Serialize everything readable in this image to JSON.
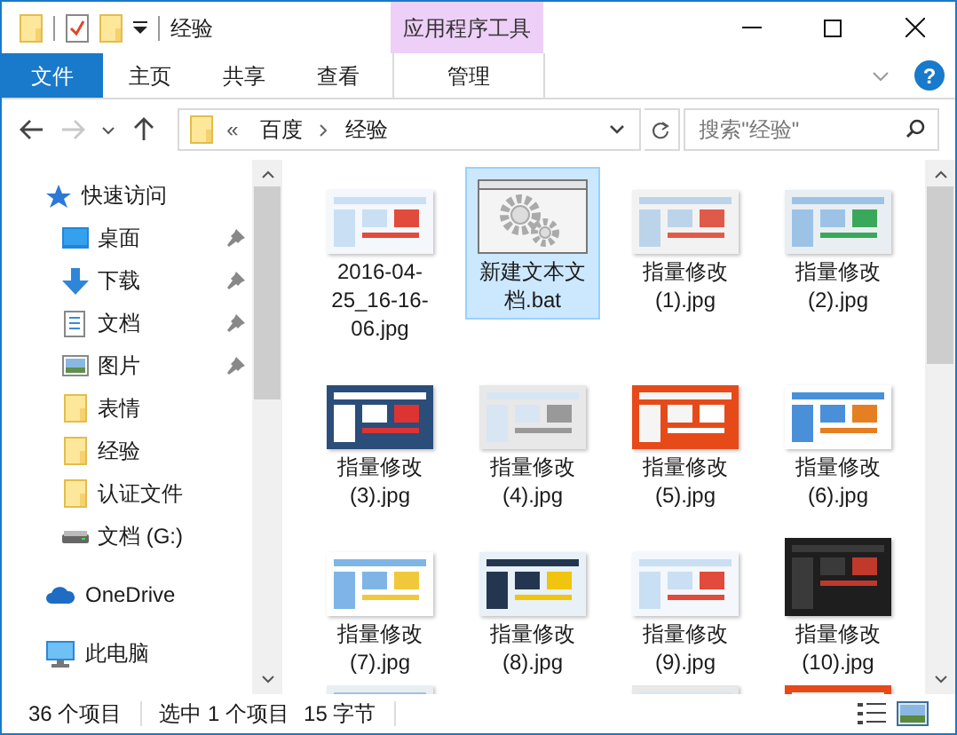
{
  "window": {
    "title": "经验"
  },
  "context_tab": {
    "label": "应用程序工具"
  },
  "ribbon_tabs": [
    {
      "label": "文件",
      "kind": "file"
    },
    {
      "label": "主页",
      "kind": "normal"
    },
    {
      "label": "共享",
      "kind": "normal"
    },
    {
      "label": "查看",
      "kind": "normal"
    },
    {
      "label": "管理",
      "kind": "context"
    }
  ],
  "help_button": {
    "label": "?"
  },
  "navigation_buttons": {
    "forward_disabled": true
  },
  "address": {
    "overflow": "«",
    "path": [
      "百度",
      "经验"
    ]
  },
  "search": {
    "placeholder": "搜索\"经验\""
  },
  "sidebar": [
    {
      "label": "快速访问",
      "kind": "quick",
      "children": [
        {
          "label": "桌面",
          "kind": "desktop",
          "pinned": true
        },
        {
          "label": "下载",
          "kind": "download",
          "pinned": true
        },
        {
          "label": "文档",
          "kind": "document",
          "pinned": true
        },
        {
          "label": "图片",
          "kind": "pictures",
          "pinned": true
        },
        {
          "label": "表情",
          "kind": "folder",
          "pinned": false
        },
        {
          "label": "经验",
          "kind": "folder",
          "pinned": false
        },
        {
          "label": "认证文件",
          "kind": "folder",
          "pinned": false
        },
        {
          "label": "文档 (G:)",
          "kind": "drive",
          "pinned": false
        }
      ]
    },
    {
      "label": "OneDrive",
      "kind": "cloud"
    },
    {
      "label": "此电脑",
      "kind": "pc"
    }
  ],
  "files": [
    {
      "name": "2016-04-25_16-16-06.jpg",
      "selected": false
    },
    {
      "name": "新建文本文档.bat",
      "kind": "batch",
      "selected": true
    },
    {
      "name": "指量修改(1).jpg",
      "selected": false
    },
    {
      "name": "指量修改(2).jpg",
      "selected": false
    },
    {
      "name": "指量修改(3).jpg",
      "selected": false
    },
    {
      "name": "指量修改(4).jpg",
      "selected": false
    },
    {
      "name": "指量修改(5).jpg",
      "selected": false
    },
    {
      "name": "指量修改(6).jpg",
      "selected": false
    },
    {
      "name": "指量修改(7).jpg",
      "selected": false
    },
    {
      "name": "指量修改(8).jpg",
      "selected": false
    },
    {
      "name": "指量修改(9).jpg",
      "selected": false
    },
    {
      "name": "指量修改(10).jpg",
      "selected": false
    }
  ],
  "partial_row": [
    {
      "kind": "picture"
    },
    {
      "kind": "empty"
    },
    {
      "kind": "picture"
    },
    {
      "kind": "picture"
    }
  ],
  "status_bar": {
    "count": "36 个项目",
    "selection": "选中 1 个项目",
    "size": "15 字节"
  }
}
